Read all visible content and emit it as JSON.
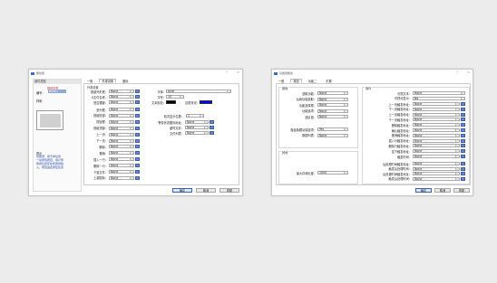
{
  "win1": {
    "title": "属性框",
    "controls": {
      "minimize": "?",
      "close": "×"
    },
    "sidebar": {
      "header": "部件类型",
      "type_value": "按钮控件",
      "id_label": "编号：",
      "id_value": "B0001",
      "preview_label": "样例",
      "tip_label": "提示",
      "tip_lines": [
        "功能键：用于向位置",
        "一动键值按钮，用户所",
        "按键位置区处所按键输",
        "入，按钮由此按钮处置"
      ]
    },
    "tabs": [
      "一般",
      "外观设置",
      "图标"
    ],
    "group_label": "外观设置",
    "left_rows": [
      {
        "label": "按键外形框：",
        "value": "None"
      },
      {
        "label": "X文件名称：",
        "value": "None"
      },
      {
        "label": "是否镶嵌：",
        "value": "None"
      },
      {
        "label": "呈列框：",
        "value": "None"
      },
      {
        "label": "按键底部：",
        "value": "None"
      },
      {
        "label": "按钮框：",
        "value": "None"
      },
      {
        "label": "按键顶部：",
        "value": "None"
      },
      {
        "label": "上一页：",
        "value": "None"
      },
      {
        "label": "下一页：",
        "value": "None"
      },
      {
        "label": "删除：",
        "value": "None"
      },
      {
        "label": "撤销：",
        "value": "None"
      },
      {
        "label": "插入一行：",
        "value": "None"
      },
      {
        "label": "删除一行：",
        "value": "None"
      },
      {
        "label": "下载文件：",
        "value": "None"
      },
      {
        "label": "上载图标：",
        "value": "None"
      }
    ],
    "font_label": "字体：",
    "font_value": "Arial",
    "size_label": "字号：",
    "size_value": "10",
    "textcolor_label": "文本颜色：",
    "bgcolor_label": "边框背景：",
    "textcolor": "#000000",
    "bgcolor": "#0000ff",
    "decimals_label": "精灵显示位数：",
    "decimals_value": "1",
    "right_rows": [
      {
        "label": "警告状态图标地址：",
        "value": "None"
      },
      {
        "label": "超时文件：",
        "value": "None"
      },
      {
        "label": "文件列表：",
        "value": "None"
      }
    ],
    "buttons": {
      "ok": "确定",
      "cancel": "取消",
      "help": "帮助"
    }
  },
  "win2": {
    "title": "功能键属性",
    "controls": {
      "minimize": "?",
      "close": "×"
    },
    "tabs": [
      "一般",
      "按钮",
      "功能二",
      "扩展"
    ],
    "group_basic": "基础",
    "group_other": "其他",
    "group_right": "操作",
    "left_rows": [
      {
        "label": "选取功能：",
        "value": "None"
      },
      {
        "label": "后续功能选取：",
        "value": "None"
      },
      {
        "label": "功能选择框：",
        "value": "None"
      },
      {
        "label": "功能选项：",
        "value": "None"
      },
      {
        "label": "选区值：",
        "value": "None"
      }
    ],
    "left_rows2": [
      {
        "label": "隐含隐藏功能选项：",
        "value": "Yes"
      },
      {
        "label": "数据列表：",
        "value": "None"
      }
    ],
    "maxlen_label": "最大存储长度：",
    "maxlen_value": "1000",
    "right_top": [
      {
        "label": "可视文本：",
        "value": "None"
      },
      {
        "label": "可视化显示：",
        "value": "No"
      }
    ],
    "right_rows": [
      {
        "label": "上一页触发地址：",
        "value": "None"
      },
      {
        "label": "下一页触发地址：",
        "value": "None"
      },
      {
        "label": "上一页触发地址：",
        "value": "None"
      },
      {
        "label": "下一页触发地址：",
        "value": "None"
      },
      {
        "label": "删除触发地址：",
        "value": "None"
      },
      {
        "label": "确认触发地址：",
        "value": "None"
      },
      {
        "label": "撤消触发地址：",
        "value": "None"
      },
      {
        "label": "插入行触发地址：",
        "value": "None"
      },
      {
        "label": "删除行触发地址：",
        "value": "None"
      },
      {
        "label": "显下触发地址：",
        "value": "None"
      },
      {
        "label": "触发时间：",
        "value": "None"
      }
    ],
    "right_bottom": [
      {
        "label": "后处理时间触发地址：",
        "value": "None"
      },
      {
        "label": "触发后处理时间：",
        "value": "None"
      },
      {
        "label": "后处理时间触发地址：",
        "value": "None"
      },
      {
        "label": "触发后处理时间：",
        "value": "None"
      }
    ],
    "buttons": {
      "ok": "确定",
      "cancel": "取消",
      "help": "帮助"
    }
  }
}
